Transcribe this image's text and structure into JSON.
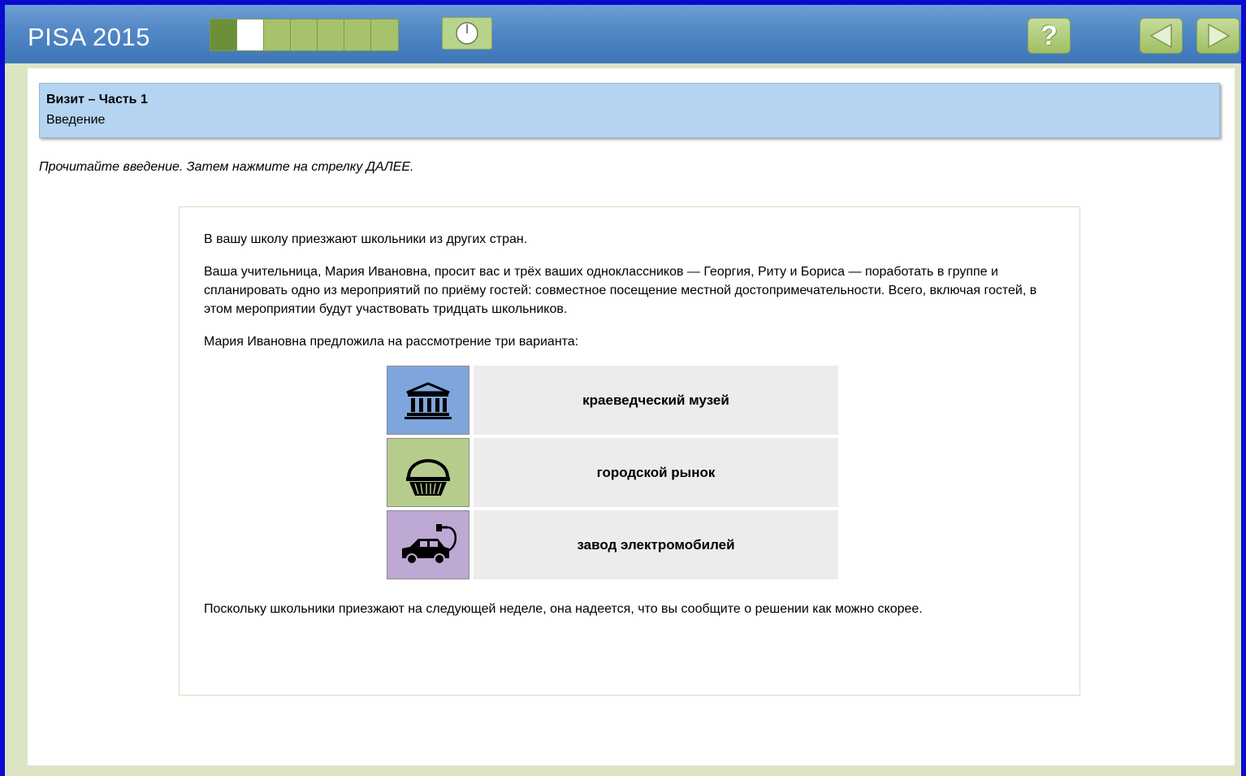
{
  "app": {
    "title": "PISA 2015"
  },
  "progress": {
    "total_steps": 7,
    "completed_steps": 1,
    "current_step": 2
  },
  "toolbar": {
    "timer_icon": "clock-icon",
    "help_icon": "question-mark-icon",
    "back_icon": "arrow-left-icon",
    "next_icon": "arrow-right-icon",
    "help_label": "?"
  },
  "header": {
    "unit_title": "Визит – Часть 1",
    "unit_subtitle": "Введение"
  },
  "instruction": "Прочитайте введение. Затем нажмите на стрелку ДАЛЕЕ.",
  "stimulus": {
    "paragraph_1": "В вашу школу приезжают школьники из других стран.",
    "paragraph_2": "Ваша учительница, Мария Ивановна, просит вас и трёх ваших одноклассников — Георгия, Риту и Бориса — поработать в группе и спланировать одно из мероприятий по приёму гостей: совместное посещение местной достопримечательности. Всего, включая гостей, в этом мероприятии будут участвовать тридцать школьников.",
    "paragraph_3": "Мария Ивановна предложила на рассмотрение три варианта:",
    "options": [
      {
        "icon": "museum-icon",
        "label": "краеведческий музей",
        "color": "#7ea6dc"
      },
      {
        "icon": "basket-icon",
        "label": "городской рынок",
        "color": "#b6cc8d"
      },
      {
        "icon": "electric-car-icon",
        "label": "завод электромобилей",
        "color": "#bea8d4"
      }
    ],
    "paragraph_4": "Поскольку школьники приезжают на следующей неделе, она надеется, что вы сообщите о решении как можно скорее."
  },
  "colors": {
    "outer_border": "#0a0ad2",
    "topbar": "#5187c6",
    "header_box": "#b4d4f2",
    "progress_done": "#6e8f3a",
    "progress_pending": "#a7c26b"
  }
}
